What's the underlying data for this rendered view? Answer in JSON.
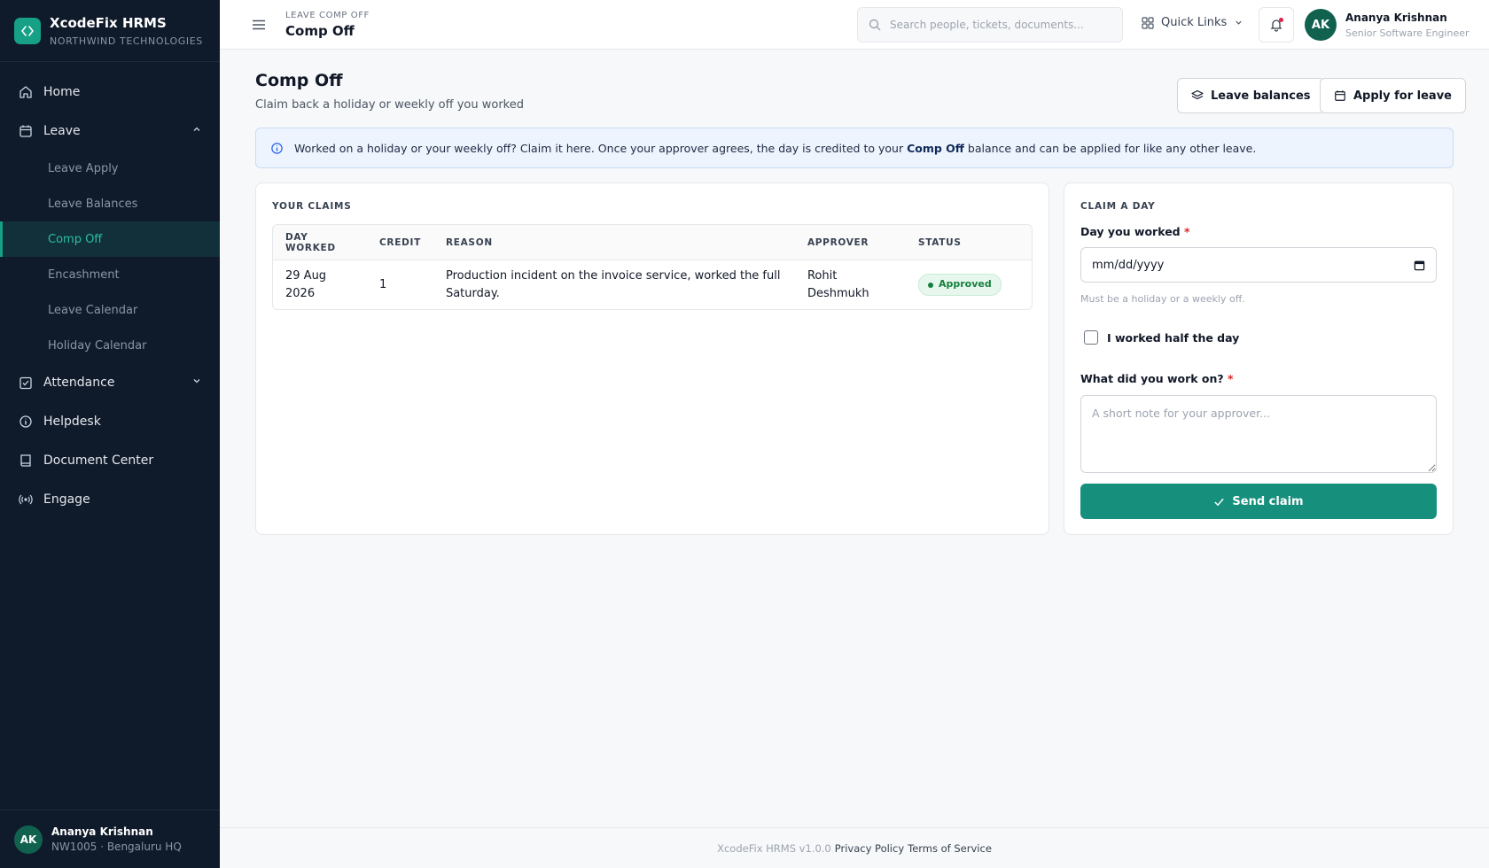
{
  "brand": {
    "name": "XcodeFix HRMS",
    "org": "NORTHWIND TECHNOLOGIES"
  },
  "sidebar": {
    "items": [
      {
        "label": "Home",
        "icon": "home-icon"
      },
      {
        "label": "Leave",
        "icon": "calendar-icon",
        "expanded": true,
        "children": [
          "Leave Apply",
          "Leave Balances",
          "Comp Off",
          "Encashment",
          "Leave Calendar",
          "Holiday Calendar"
        ],
        "active_child": "Comp Off"
      },
      {
        "label": "Attendance",
        "icon": "checkbox-calendar-icon",
        "expanded": false
      },
      {
        "label": "Helpdesk",
        "icon": "info-circle-icon"
      },
      {
        "label": "Document Center",
        "icon": "book-icon"
      },
      {
        "label": "Engage",
        "icon": "broadcast-icon"
      }
    ],
    "user": {
      "initials": "AK",
      "name": "Ananya Krishnan",
      "sub": "NW1005 · Bengaluru HQ"
    }
  },
  "topbar": {
    "breadcrumb": "LEAVE COMP OFF",
    "title": "Comp Off",
    "search_placeholder": "Search people, tickets, documents...",
    "quick_links": "Quick Links",
    "user": {
      "initials": "AK",
      "name": "Ananya Krishnan",
      "role": "Senior Software Engineer"
    }
  },
  "page": {
    "title": "Comp Off",
    "subtitle": "Claim back a holiday or weekly off you worked",
    "buttons": {
      "leave_balances": "Leave balances",
      "apply_leave": "Apply for leave"
    },
    "info": {
      "before": "Worked on a holiday or your weekly off? Claim it here. Once your approver agrees, the day is credited to your ",
      "bold": "Comp Off",
      "after": " balance and can be applied for like any other leave."
    }
  },
  "claims": {
    "label": "YOUR CLAIMS",
    "columns": [
      "DAY WORKED",
      "CREDIT",
      "REASON",
      "APPROVER",
      "STATUS"
    ],
    "rows": [
      {
        "day": "29 Aug 2026",
        "credit": "1",
        "reason": "Production incident on the invoice service, worked the full Saturday.",
        "approver": "Rohit Deshmukh",
        "status": "Approved"
      }
    ]
  },
  "form": {
    "label": "CLAIM A DAY",
    "day_label": "Day you worked",
    "required_mark": "*",
    "date_placeholder": "mm/dd/yyyy",
    "hint": "Must be a holiday or a weekly off.",
    "half_day_label": "I worked half the day",
    "half_day_checked": false,
    "work_label": "What did you work on?",
    "work_placeholder": "A short note for your approver...",
    "submit": "Send claim"
  },
  "footer": {
    "version": "XcodeFix HRMS v1.0.0",
    "privacy": "Privacy Policy",
    "terms": "Terms of Service"
  },
  "colors": {
    "sidebar_bg": "#0f1a2b",
    "accent": "#168f7d",
    "active_text": "#2bbf9d",
    "approved": "#15803d"
  }
}
